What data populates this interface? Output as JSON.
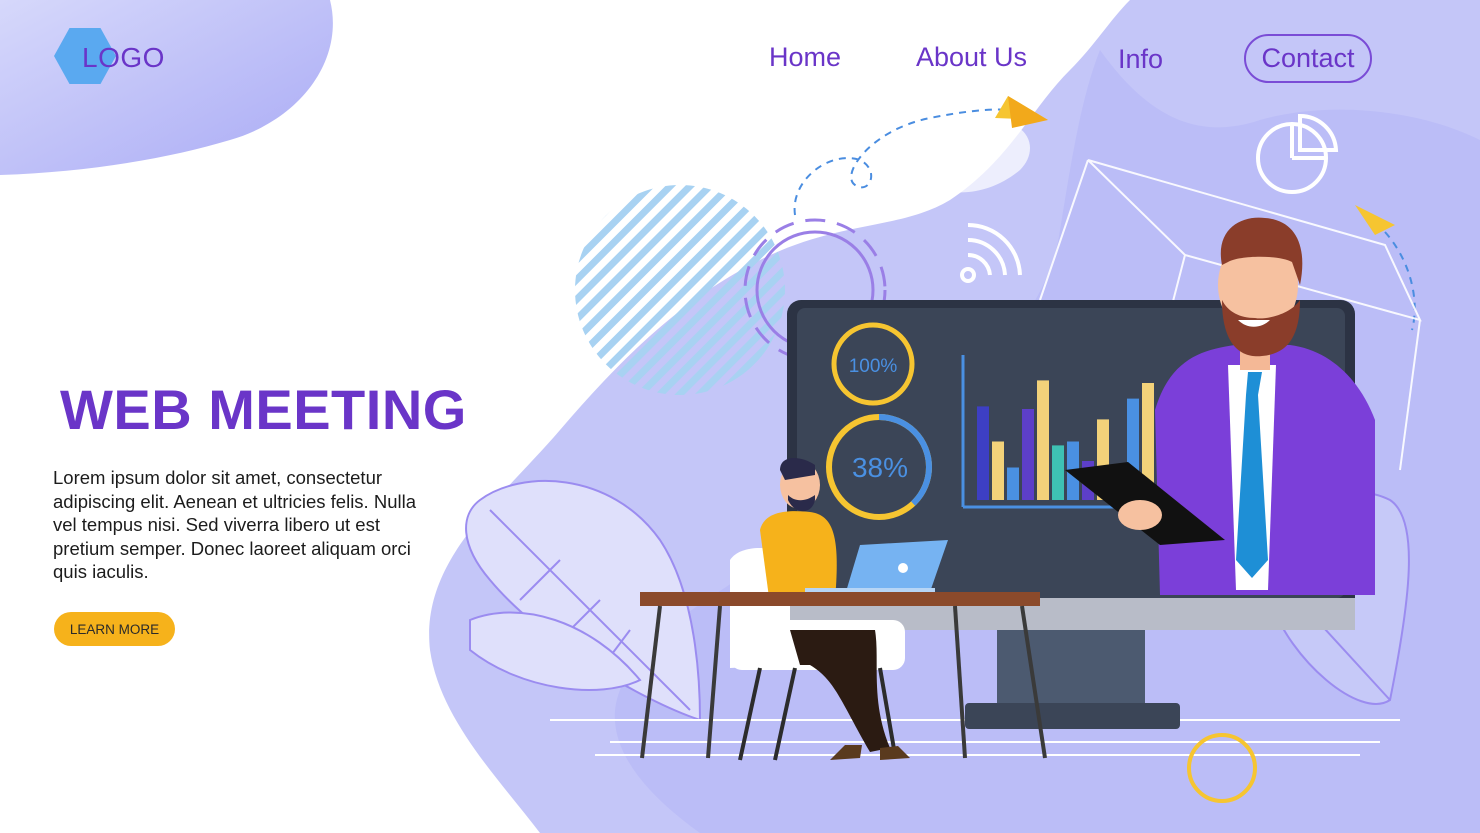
{
  "header": {
    "logo": "LOGO",
    "nav": [
      "Home",
      "About Us",
      "Info",
      "Contact"
    ]
  },
  "hero": {
    "title": "WEB MEETING",
    "body": "Lorem ipsum dolor sit amet, consectetur adipiscing elit. Aenean et ultricies felis. Nulla vel tempus nisi. Sed viverra libero ut est pretium semper. Donec laoreet aliquam orci quis iaculis.",
    "cta": "LEARN MORE"
  },
  "illustration": {
    "progress_rings": [
      {
        "label": "100%",
        "value": 1.0
      },
      {
        "label": "38%",
        "value": 0.38
      }
    ],
    "bar_values": [
      0.72,
      0.45,
      0.25,
      0.7,
      0.92,
      0.42,
      0.45,
      0.3,
      0.62,
      0.2,
      0.78,
      0.9
    ]
  },
  "colors": {
    "brand": "#6a35c8",
    "accent": "#f6b21b",
    "lavender": "#b7baf8",
    "screen": "#3b4557"
  }
}
